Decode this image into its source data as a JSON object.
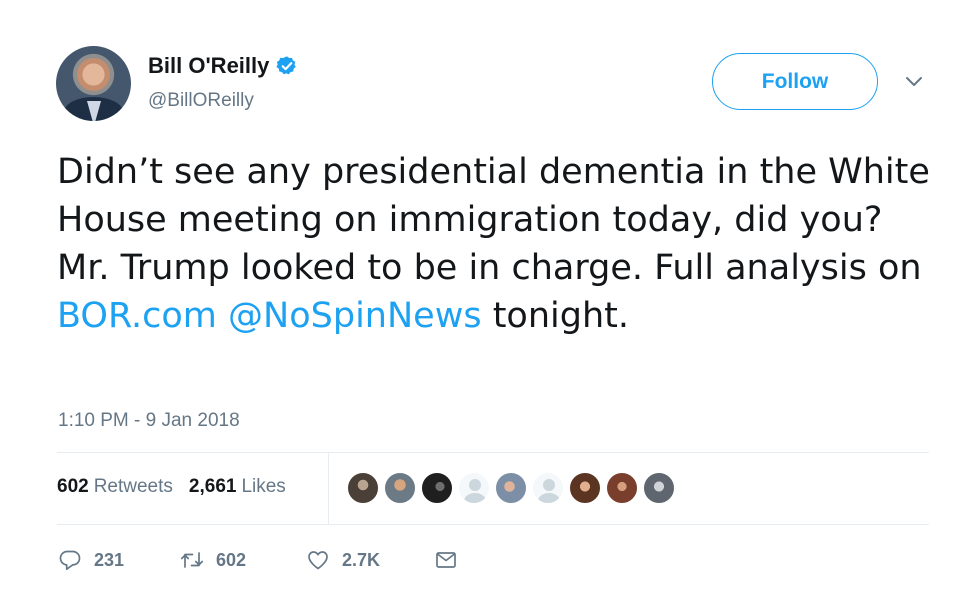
{
  "author": {
    "display_name": "Bill O'Reilly",
    "handle": "@BillOReilly",
    "verified": true
  },
  "follow_label": "Follow",
  "tweet": {
    "text_before_links": "Didn’t see any presidential dementia in the White House meeting on immigration today, did you? Mr. Trump looked to be in charge. Full analysis on ",
    "link_1": "BOR.com",
    "link_2": "@NoSpinNews",
    "text_after_links": " tonight."
  },
  "timestamp": "1:10 PM - 9 Jan 2018",
  "stats": {
    "retweets_count": "602",
    "retweets_label": "Retweets",
    "likes_count": "2,661",
    "likes_label": "Likes"
  },
  "actions": {
    "replies": "231",
    "retweets": "602",
    "likes": "2.7K"
  },
  "colors": {
    "accent": "#1da1f2",
    "secondary_text": "#657786",
    "primary_text": "#14171a",
    "divider": "#e6ecf0"
  },
  "liker_avatars": [
    "dark",
    "photo",
    "dark",
    "default",
    "photo",
    "default",
    "photo",
    "photo",
    "photo"
  ],
  "icons": [
    "verified-badge-icon",
    "chevron-down-icon",
    "reply-icon",
    "retweet-icon",
    "heart-icon",
    "message-icon"
  ]
}
